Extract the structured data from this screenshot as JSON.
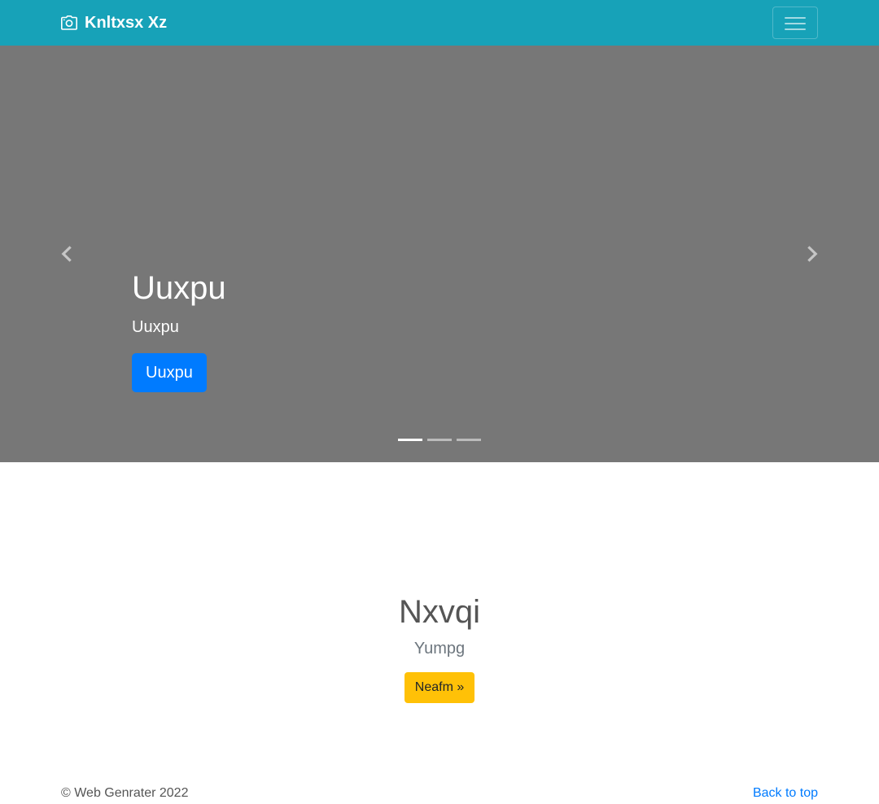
{
  "navbar": {
    "brand": "Knltxsx Xz",
    "brand_icon": "camera-icon",
    "toggler_icon": "hamburger-icon",
    "background": "#17a2b8"
  },
  "carousel": {
    "background": "#777777",
    "prev_icon": "chevron-left-icon",
    "next_icon": "chevron-right-icon",
    "slide": {
      "title": "Uuxpu",
      "subtitle": "Uuxpu",
      "button_label": "Uuxpu"
    },
    "indicators": [
      {
        "active": true
      },
      {
        "active": false
      },
      {
        "active": false
      }
    ]
  },
  "feature": {
    "title": "Nxvqi",
    "subtitle": "Yumpg",
    "button_label": "Neafm »"
  },
  "footer": {
    "copyright": "© Web Genrater 2022",
    "back_to_top": "Back to top"
  },
  "colors": {
    "primary": "#007bff",
    "warning": "#ffc107",
    "accent": "#17a2b8"
  }
}
